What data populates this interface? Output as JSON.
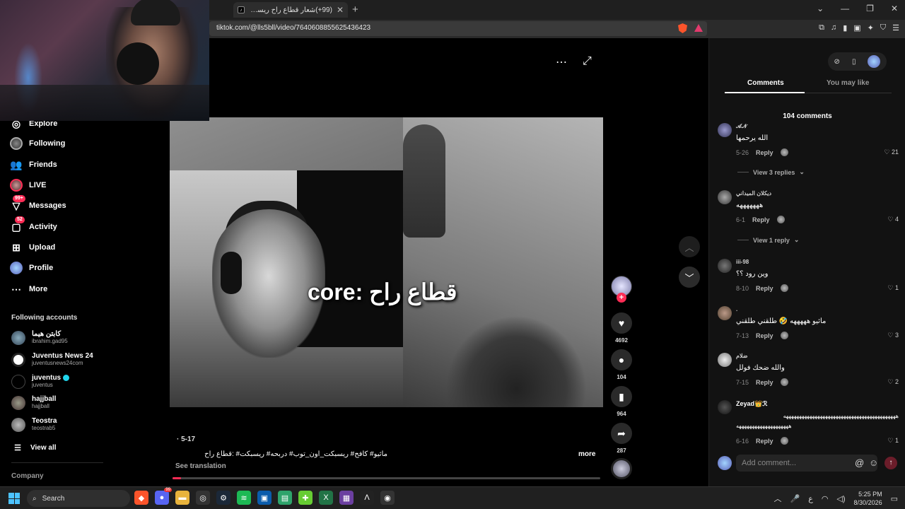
{
  "browser": {
    "tab_title": "(99+)شعار قطاع راح ريسبكت — ع",
    "tab_favicon": "tiktok-icon",
    "url": "tiktok.com/@lls5bll/video/7640608855625436423"
  },
  "nav": {
    "explore": "Explore",
    "following": "Following",
    "friends": "Friends",
    "live": "LIVE",
    "messages": "Messages",
    "messages_badge": "99+",
    "activity": "Activity",
    "activity_badge": "52",
    "upload": "Upload",
    "profile": "Profile",
    "more": "More"
  },
  "following_accounts": {
    "title": "Following accounts",
    "accounts": [
      {
        "name": "كابتن هيما",
        "handle": "ibrahim.gad95"
      },
      {
        "name": "Juventus News 24",
        "handle": "juventusnews24com"
      },
      {
        "name": "juventus",
        "handle": "juventus",
        "verified": true
      },
      {
        "name": "hajjball",
        "handle": "hajjball"
      },
      {
        "name": "Teostra",
        "handle": "teostrab5"
      }
    ],
    "view_all": "View all"
  },
  "footer": {
    "company": "Company"
  },
  "video": {
    "caption": "core: قطاع راح",
    "date": "· 5-17",
    "description": "ماثيو# كافح# ريسبكت_اون_توب# دربحه# ريسبكت# :قطاع راح",
    "more": "more",
    "see_translation": "See translation",
    "progress": 0.02
  },
  "actions": {
    "likes": "4692",
    "comments": "104",
    "saves": "964",
    "shares": "287"
  },
  "panel": {
    "tab_comments": "Comments",
    "tab_you_may_like": "You may like",
    "comment_count": "104 comments",
    "input_placeholder": "Add comment...",
    "comments": [
      {
        "user": "𝓐𝓝",
        "text": "الله يرحمها",
        "date": "5-26",
        "reply": "Reply",
        "likes": "21",
        "replies": "View 3 replies"
      },
      {
        "user": "ديكلان الميداني",
        "text": "هههههههه",
        "date": "6-1",
        "reply": "Reply",
        "likes": "4",
        "replies": "View 1 reply"
      },
      {
        "user": "iii-98",
        "text": "وين رود ؟؟",
        "date": "8-10",
        "reply": "Reply",
        "likes": "1"
      },
      {
        "user": ".",
        "text": "ماثيو هههههه 🤣 طلقني طلقني",
        "date": "7-13",
        "reply": "Reply",
        "likes": "3"
      },
      {
        "user": "ضلام",
        "text": "والله ضحك فولل",
        "date": "7-15",
        "reply": "Reply",
        "likes": "2"
      },
      {
        "user": "Zeyad👑ℛ",
        "text": "هههههههههههههههههههههههههههههههههههههههههههه",
        "text2": "ههههههههههههههههههههه",
        "date": "6-16",
        "reply": "Reply",
        "likes": "1"
      }
    ]
  },
  "taskbar": {
    "search": "Search",
    "lang": "ع",
    "time": "5:25 PM",
    "date": "8/30/2026",
    "discord_badge": "99"
  },
  "colors": {
    "accent": "#fe2c55",
    "panel_bg": "#121212",
    "taskbar_bg": "#202020"
  }
}
